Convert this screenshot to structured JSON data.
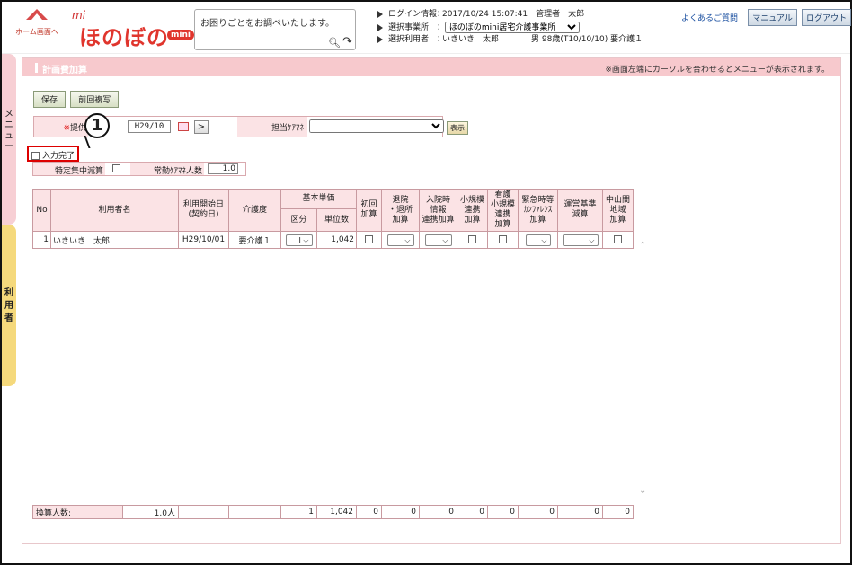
{
  "header": {
    "home_label": "ホーム画面へ",
    "logo_prefix": "mi",
    "logo_main": "ほのぼの",
    "logo_badge": "mini",
    "search_placeholder": "お困りごとをお調べいたします。",
    "login_label": "ログイン情報：",
    "login_value": "2017/10/24 15:07:41　管理者　太郎",
    "office_label": "選択事業所　：",
    "office_value": "ほのぼのmini居宅介護事業所",
    "user_label": "選択利用者　：",
    "user_value": "いきいき　太郎　　　　男 98歳(T10/10/10) 要介護１",
    "faq": "よくあるご質問",
    "manual": "マニュアル",
    "logout": "ログアウト"
  },
  "side": {
    "menu_label": "メニュー",
    "user_label": "利用者"
  },
  "panel": {
    "title": "計画費加算",
    "hint": "※画面左端にカーソルを合わせるとメニューが表示されます。",
    "save": "保存",
    "copy_prev": "前回複写",
    "provider_required_mark": "※",
    "provider_label": "提供",
    "provider_date": "H29/10",
    "arrow": ">",
    "manager_label": "担当ｹｱﾏﾈ",
    "manager_value": "",
    "show_button": "表示",
    "callout_number": "1",
    "input_done": "入力完了",
    "special_label": "特定集中減算",
    "fulltime_label": "常勤ｹｱﾏﾈ人数",
    "fulltime_value": "1.0"
  },
  "table": {
    "headers": {
      "no": "No",
      "name": "利用者名",
      "start_l1": "利用開始日",
      "start_l2": "(契約日)",
      "care_level": "介護度",
      "basic_unit": "基本単価",
      "category": "区分",
      "units": "単位数",
      "initial_l1": "初回",
      "initial_l2": "加算",
      "discharge_l1": "退院",
      "discharge_l2": "・退所",
      "discharge_l3": "加算",
      "admission_l1": "入院時",
      "admission_l2": "情報",
      "admission_l3": "連携加算",
      "small_l1": "小規模",
      "small_l2": "連携",
      "small_l3": "加算",
      "nursing_l1": "看護",
      "nursing_l2": "小規模",
      "nursing_l3": "連携",
      "nursing_l4": "加算",
      "emergency_l1": "緊急時等",
      "emergency_l2": "ｶﾝﾌｧﾚﾝｽ",
      "emergency_l3": "加算",
      "operation_l1": "運営基準",
      "operation_l2": "減算",
      "mountain_l1": "中山間",
      "mountain_l2": "地域",
      "mountain_l3": "加算"
    },
    "rows": [
      {
        "no": "1",
        "name": "いきいき　太郎",
        "start": "H29/10/01",
        "care_level": "要介護１",
        "category": "Ⅰ",
        "units": "1,042"
      }
    ]
  },
  "totals": {
    "label": "換算人数:",
    "people": "1.0人",
    "category_total": "1",
    "units_total": "1,042",
    "initial": "0",
    "discharge": "0",
    "admission": "0",
    "small": "0",
    "nursing": "0",
    "emergency": "0",
    "operation": "0",
    "mountain": "0"
  },
  "colors": {
    "accent_pink": "#f7c9cd",
    "header_cell": "#fbe3e5",
    "highlight_red": "#dd0000",
    "side_yellow": "#f5d97c"
  }
}
